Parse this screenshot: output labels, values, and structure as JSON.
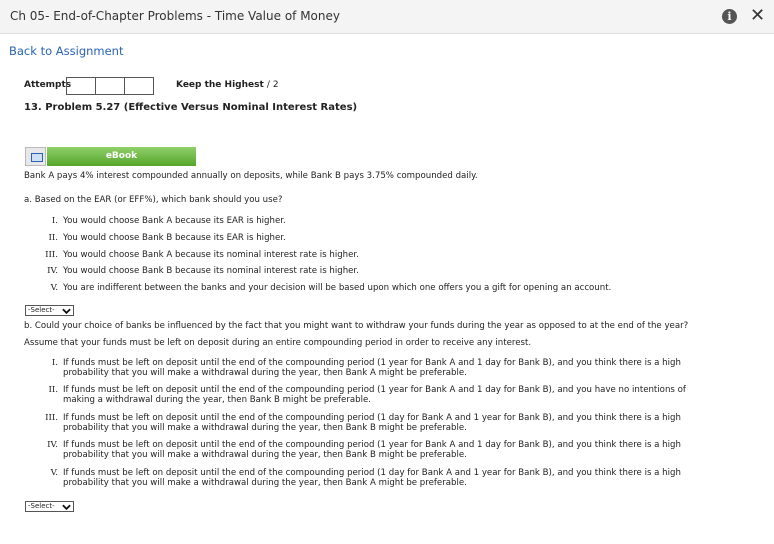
{
  "window": {
    "title": "Ch 05- End-of-Chapter Problems - Time Value of Money"
  },
  "nav": {
    "back_label": "Back to Assignment"
  },
  "attempts": {
    "label": "Attempts",
    "keep_label": "Keep the Highest",
    "keep_value": "/ 2"
  },
  "problem": {
    "title": "13.  Problem 5.27 (Effective Versus Nominal Interest Rates)"
  },
  "ebook": {
    "label": "eBook"
  },
  "intro": "Bank A pays 4% interest compounded annually on deposits, while Bank B pays 3.75% compounded daily.",
  "part_a": {
    "question": "a. Based on the EAR (or EFF%), which bank should you use?",
    "options": [
      {
        "num": "I.",
        "text": "You would choose Bank A because its EAR is higher."
      },
      {
        "num": "II.",
        "text": "You would choose Bank B because its EAR is higher."
      },
      {
        "num": "III.",
        "text": "You would choose Bank A because its nominal interest rate is higher."
      },
      {
        "num": "IV.",
        "text": "You would choose Bank B because its nominal interest rate is higher."
      },
      {
        "num": "V.",
        "text": "You are indifferent between the banks and your decision will be based upon which one offers you a gift for opening an account."
      }
    ],
    "select_value": "-Select-"
  },
  "part_b": {
    "question_line1": "b. Could your choice of banks be influenced by the fact that you might want to withdraw your funds during the year as opposed to at the end of the year?",
    "question_line2": "Assume that your funds must be left on deposit during an entire compounding period in order to receive any interest.",
    "options": [
      {
        "num": "I.",
        "line1": "If funds must be left on deposit until the end of the compounding period (1 year for Bank A and 1 day for Bank B), and you think there is a high",
        "line2": "probability that you will make a withdrawal during the year, then Bank A might be preferable."
      },
      {
        "num": "II.",
        "line1": "If funds must be left on deposit until the end of the compounding period (1 year for Bank A and 1 day for Bank B), and you have no intentions of",
        "line2": "making a withdrawal during the year, then Bank B might be preferable."
      },
      {
        "num": "III.",
        "line1": "If funds must be left on deposit until the end of the compounding period (1 day for Bank A and 1 year for Bank B), and you think there is a high",
        "line2": "probability that you will make a withdrawal during the year, then Bank B might be preferable."
      },
      {
        "num": "IV.",
        "line1": "If funds must be left on deposit until the end of the compounding period (1 year for Bank A and 1 day for Bank B), and you think there is a high",
        "line2": "probability that you will make a withdrawal during the year, then Bank B might be preferable."
      },
      {
        "num": "V.",
        "line1": "If funds must be left on deposit until the end of the compounding period (1 day for Bank A and 1 year for Bank B), and you think there is a high",
        "line2": "probability that you will make a withdrawal during the year, then Bank A might be preferable."
      }
    ],
    "select_value": "-Select-"
  },
  "icons": {
    "info": "info-icon",
    "close": "close-icon",
    "ebook": "book-icon",
    "dropdown": "chevron-down-icon"
  },
  "colors": {
    "link": "#2a63b3",
    "ebook_green": "#55a62a"
  }
}
